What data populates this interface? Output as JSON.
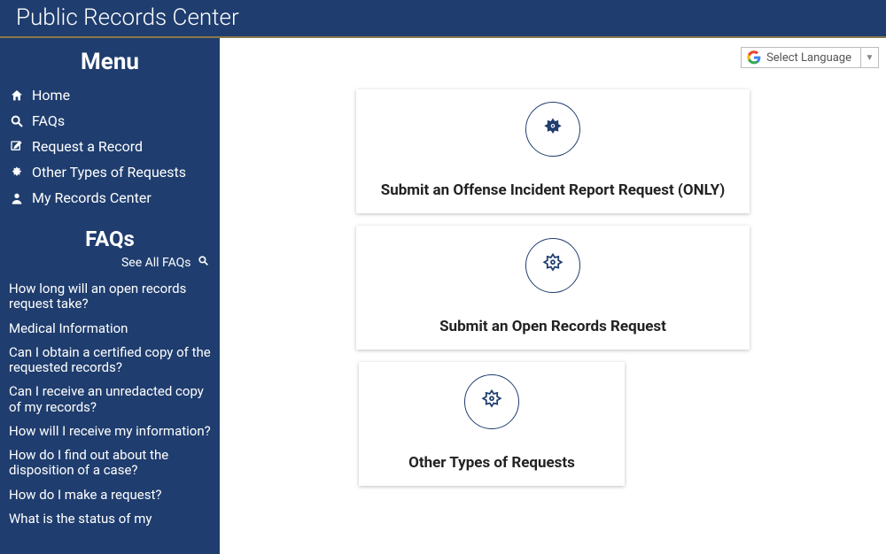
{
  "header": {
    "title": "Public Records Center"
  },
  "sidebar": {
    "menu_title": "Menu",
    "items": [
      {
        "label": "Home"
      },
      {
        "label": "FAQs"
      },
      {
        "label": "Request a Record"
      },
      {
        "label": "Other Types of Requests"
      },
      {
        "label": "My Records Center"
      }
    ],
    "faqs_title": "FAQs",
    "see_all_label": "See All FAQs",
    "faq_items": [
      "How long will an open records request take?",
      "Medical Information",
      "Can I obtain a certified copy of the requested records?",
      "Can I receive an unredacted copy of my records?",
      "How will I receive my information?",
      "How do I find out about the disposition of a case?",
      "How do I make a request?",
      "What is the status of my"
    ]
  },
  "lang": {
    "label": "Select Language"
  },
  "cards": [
    {
      "title": "Submit an Offense Incident Report Request (ONLY)"
    },
    {
      "title": "Submit an Open Records Request"
    },
    {
      "title": "Other Types of Requests"
    }
  ],
  "colors": {
    "brand": "#1f3d6e"
  }
}
